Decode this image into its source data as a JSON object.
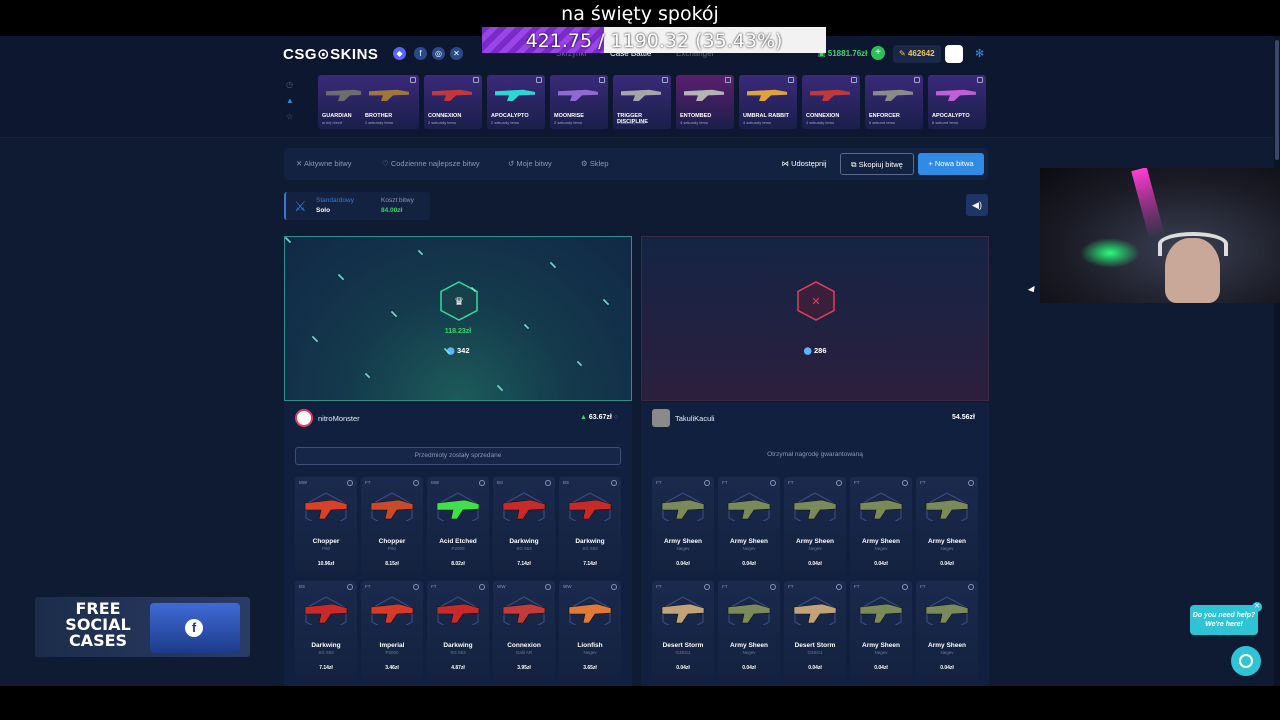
{
  "stream": {
    "title": "na święty spokój",
    "progress_text": "421.75 / 1190.32 (35.43%)",
    "progress_fraction": 0.3543
  },
  "header": {
    "logo": "CSG⊙SKINS",
    "nav": [
      "Skrzynki",
      "Case Battle",
      "Exchanger"
    ],
    "active_nav": "Case Battle",
    "balance": "51881.76zł",
    "coins": "462642",
    "accent": "#2f8ce6"
  },
  "drops": [
    {
      "name": "GUARDIAN",
      "sub": "w nej niezit",
      "bg": "#3a2a7a",
      "gun": "#6d6d6d"
    },
    {
      "name": "BROTHER",
      "sub": "2 sekundy temu",
      "bg": "#3a2a7a",
      "gun": "#a0763a"
    },
    {
      "name": "CONNEXION",
      "sub": "2 sekundy temu",
      "bg": "#3a2a7a",
      "gun": "#c2373a"
    },
    {
      "name": "APOCALYPTO",
      "sub": "2 sekundy temu",
      "bg": "#3a2a7a",
      "gun": "#2bd7d0"
    },
    {
      "name": "MOONRISE",
      "sub": "2 sekundy temu",
      "bg": "#3a2a7a",
      "gun": "#8d6ad4"
    },
    {
      "name": "TRIGGER DISCIPLINE",
      "sub": "3 sekundy temu",
      "bg": "#3a2a7a",
      "gun": "#a6a6a6"
    },
    {
      "name": "ENTOMBED",
      "sub": "4 sekundy temu",
      "bg": "#5a1f6e",
      "gun": "#b5b5b5"
    },
    {
      "name": "UMBRAL RABBIT",
      "sub": "4 sekundy temu",
      "bg": "#3a2a7a",
      "gun": "#e0a23c"
    },
    {
      "name": "CONNEXION",
      "sub": "4 sekundy temu",
      "bg": "#3a2a7a",
      "gun": "#c2373a"
    },
    {
      "name": "ENFORCER",
      "sub": "6 sekund temu",
      "bg": "#3a2a7a",
      "gun": "#8a8a8a"
    },
    {
      "name": "APOCALYPTO",
      "sub": "6 sekund temu",
      "bg": "#3a2a7a",
      "gun": "#c25fd6"
    }
  ],
  "tabs": [
    "Aktywne bitwy",
    "Codzienne najlepsze bitwy",
    "Moje bitwy",
    "Sklep"
  ],
  "actions": {
    "share": "Udostępnij",
    "copy": "Skopiuj bitwę",
    "new": "+ Nowa bitwa"
  },
  "battle_info": {
    "mode": "Standardowy",
    "type": "Solo",
    "cost_label": "Koszt bitwy",
    "cost": "84.00zł"
  },
  "arenas": [
    {
      "amount": "118.23zł",
      "tokens": "342",
      "result": "win"
    },
    {
      "amount": "",
      "tokens": "286",
      "result": "lose"
    }
  ],
  "players": [
    {
      "name": "nitroMonster",
      "total": "63.67zł",
      "note": "Przedmioty zostały sprzedane",
      "items": [
        {
          "wear": "MW",
          "name": "Chopper",
          "weapon": "P90",
          "price": "10.96zł",
          "color": "#d8402a"
        },
        {
          "wear": "FT",
          "name": "Chopper",
          "weapon": "P90",
          "price": "8.15zł",
          "color": "#c84a2a"
        },
        {
          "wear": "MW",
          "name": "Acid Etched",
          "weapon": "P2000",
          "price": "8.02zł",
          "color": "#3fe04a"
        },
        {
          "wear": "BS",
          "name": "Darkwing",
          "weapon": "SG 553",
          "price": "7.14zł",
          "color": "#c82a2a"
        },
        {
          "wear": "BS",
          "name": "Darkwing",
          "weapon": "SG 553",
          "price": "7.14zł",
          "color": "#c82a2a"
        },
        {
          "wear": "BS",
          "name": "Darkwing",
          "weapon": "SG 553",
          "price": "7.14zł",
          "color": "#c82a2a"
        },
        {
          "wear": "FT",
          "name": "Imperial",
          "weapon": "P2000",
          "price": "3.46zł",
          "color": "#d83a2a"
        },
        {
          "wear": "FT",
          "name": "Darkwing",
          "weapon": "SG 553",
          "price": "4.87zł",
          "color": "#c82a2a"
        },
        {
          "wear": "WW",
          "name": "Connexion",
          "weapon": "Galil AR",
          "price": "3.95zł",
          "color": "#c23a3a"
        },
        {
          "wear": "WW",
          "name": "Lionfish",
          "weapon": "Negev",
          "price": "3.65zł",
          "color": "#e07a3a"
        }
      ]
    },
    {
      "name": "TakuliKaculi",
      "total": "54.56zł",
      "note": "Otrzymał nagrodę gwarantowaną",
      "items": [
        {
          "wear": "FT",
          "name": "Army Sheen",
          "weapon": "Negev",
          "price": "0.04zł",
          "color": "#7b8a5a"
        },
        {
          "wear": "FT",
          "name": "Army Sheen",
          "weapon": "Negev",
          "price": "0.04zł",
          "color": "#7b8a5a"
        },
        {
          "wear": "FT",
          "name": "Army Sheen",
          "weapon": "Negev",
          "price": "0.04zł",
          "color": "#7b8a5a"
        },
        {
          "wear": "FT",
          "name": "Army Sheen",
          "weapon": "Negev",
          "price": "0.04zł",
          "color": "#7b8a5a"
        },
        {
          "wear": "FT",
          "name": "Army Sheen",
          "weapon": "Negev",
          "price": "0.04zł",
          "color": "#7b8a5a"
        },
        {
          "wear": "FT",
          "name": "Desert Storm",
          "weapon": "G3SG1",
          "price": "0.04zł",
          "color": "#c2a27a"
        },
        {
          "wear": "FT",
          "name": "Army Sheen",
          "weapon": "Negev",
          "price": "0.04zł",
          "color": "#7b8a5a"
        },
        {
          "wear": "FT",
          "name": "Desert Storm",
          "weapon": "G3SG1",
          "price": "0.04zł",
          "color": "#c2a27a"
        },
        {
          "wear": "FT",
          "name": "Army Sheen",
          "weapon": "Negev",
          "price": "0.04zł",
          "color": "#7b8a5a"
        },
        {
          "wear": "FT",
          "name": "Army Sheen",
          "weapon": "Negev",
          "price": "0.04zł",
          "color": "#7b8a5a"
        }
      ]
    }
  ],
  "promo": {
    "text": "FREE SOCIAL CASES"
  },
  "help": {
    "text": "Do you need help? We're here!"
  }
}
